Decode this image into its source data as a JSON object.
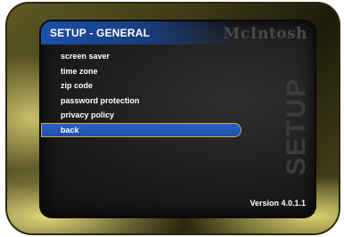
{
  "header": {
    "title": "SETUP - GENERAL",
    "logo": "McIntosh"
  },
  "menu": {
    "items": [
      {
        "label": "screen saver"
      },
      {
        "label": "time zone"
      },
      {
        "label": "zip code"
      },
      {
        "label": "password protection"
      },
      {
        "label": "privacy policy"
      },
      {
        "label": "back",
        "selected": true
      }
    ]
  },
  "watermark": "SETUP",
  "footer": {
    "version": "Version 4.0.1.1"
  },
  "colors": {
    "accent": "#1b4fa8",
    "frame": "#5f5a24",
    "screen": "#1a1a1a"
  }
}
